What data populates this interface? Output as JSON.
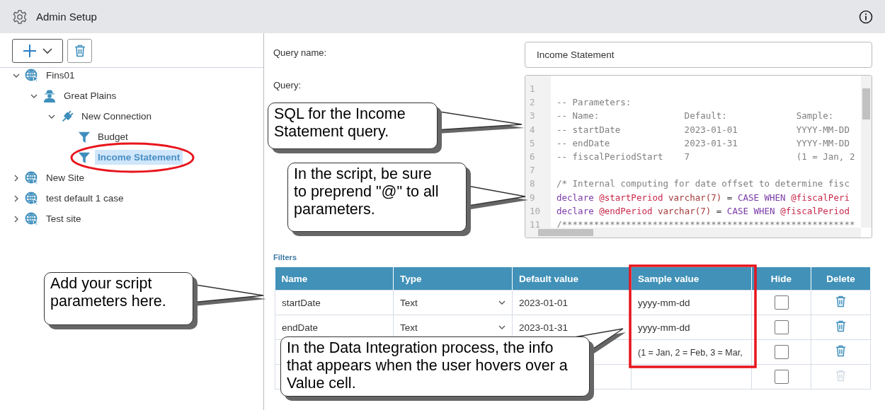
{
  "header": {
    "title": "Admin Setup"
  },
  "tree": [
    {
      "label": "Fins01",
      "kind": "site",
      "expanded": true,
      "selected": false,
      "children": [
        {
          "label": "Great Plains",
          "kind": "source",
          "expanded": true,
          "selected": false,
          "children": [
            {
              "label": "New Connection",
              "kind": "connection",
              "expanded": true,
              "selected": false,
              "children": [
                {
                  "label": "Budget",
                  "kind": "query",
                  "selected": false
                },
                {
                  "label": "Income Statement",
                  "kind": "query",
                  "selected": true
                }
              ]
            }
          ]
        }
      ]
    },
    {
      "label": "New Site",
      "kind": "site",
      "expanded": false,
      "selected": false
    },
    {
      "label": "test default 1 case",
      "kind": "site",
      "expanded": false,
      "selected": false
    },
    {
      "label": "Test site",
      "kind": "site",
      "expanded": false,
      "selected": false
    }
  ],
  "query_name": {
    "label": "Query name:",
    "value": "Income Statement"
  },
  "query": {
    "label": "Query:",
    "lines": [
      {
        "number": "1"
      },
      {
        "number": "2",
        "tokens": [
          {
            "kind": "comment",
            "text": "-- Parameters:"
          }
        ]
      },
      {
        "number": "3",
        "tokens": [
          {
            "kind": "comment",
            "text": "-- Name:                Default:             Sample:"
          }
        ]
      },
      {
        "number": "4",
        "tokens": [
          {
            "kind": "comment",
            "text": "-- startDate            2023-01-01           YYYY-MM-DD"
          }
        ]
      },
      {
        "number": "5",
        "tokens": [
          {
            "kind": "comment",
            "text": "-- endDate              2023-01-31           YYYY-MM-DD"
          }
        ]
      },
      {
        "number": "6",
        "tokens": [
          {
            "kind": "comment",
            "text": "-- fiscalPeriodStart    7                    (1 = Jan, 2"
          }
        ]
      },
      {
        "number": "7"
      },
      {
        "number": "8",
        "tokens": [
          {
            "kind": "comment",
            "text": "/* Internal computing for date offset to determine fisc"
          }
        ]
      },
      {
        "number": "9",
        "tokens": [
          {
            "kind": "keyword",
            "text": "declare "
          },
          {
            "kind": "variable",
            "text": "@startPeriod"
          },
          {
            "kind": "type",
            "text": " varchar(7) "
          },
          {
            "kind": "plain",
            "text": "= "
          },
          {
            "kind": "keyword",
            "text": "CASE WHEN "
          },
          {
            "kind": "variable",
            "text": "@fiscalPeri"
          }
        ]
      },
      {
        "number": "10",
        "tokens": [
          {
            "kind": "keyword",
            "text": "declare "
          },
          {
            "kind": "variable",
            "text": "@endPeriod"
          },
          {
            "kind": "type",
            "text": " varchar(7) "
          },
          {
            "kind": "plain",
            "text": "= "
          },
          {
            "kind": "keyword",
            "text": "CASE WHEN "
          },
          {
            "kind": "variable",
            "text": "@fiscalPeriod"
          }
        ]
      },
      {
        "number": "11",
        "tokens": [
          {
            "kind": "comment",
            "text": "/*******************************************************"
          }
        ]
      }
    ]
  },
  "filters": {
    "title": "Filters",
    "columns": [
      "Name",
      "Type",
      "Default value",
      "Sample value",
      "Hide",
      "Delete"
    ],
    "rows": [
      {
        "name": "startDate",
        "type": "Text",
        "default_value": "2023-01-01",
        "sample_value": "yyyy-mm-dd",
        "hide": false,
        "delete_disabled": false
      },
      {
        "name": "endDate",
        "type": "Text",
        "default_value": "2023-01-31",
        "sample_value": "yyyy-mm-dd",
        "hide": false,
        "delete_disabled": false
      },
      {
        "sample_value": "(1 = Jan, 2 = Feb, 3 = Mar,",
        "hide": false,
        "delete_disabled": false
      },
      {
        "hide": false,
        "delete_disabled": true
      }
    ]
  },
  "callouts": [
    {
      "text": "SQL for the Income Statement query."
    },
    {
      "text": "In the script, be sure to preprend \"@\" to all parameters."
    },
    {
      "text": "Add your script parameters here."
    },
    {
      "text": "In the Data Integration process, the info that appears when the user hovers over a Value cell."
    }
  ]
}
